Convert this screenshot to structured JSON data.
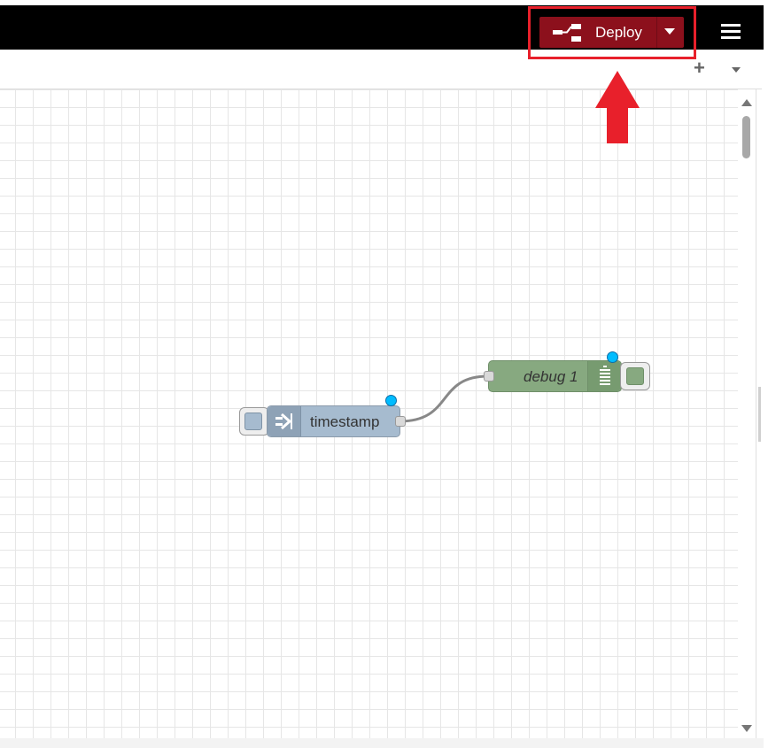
{
  "header": {
    "deploy_label": "Deploy",
    "deploy_icon": "deploy-icon",
    "menu_icon": "hamburger-menu-icon"
  },
  "tabbar": {
    "add_label": "+",
    "more_icon": "caret-down-icon"
  },
  "nodes": {
    "inject": {
      "label": "timestamp",
      "icon": "arrow-in-icon",
      "type": "inject"
    },
    "debug": {
      "label": "debug 1",
      "icon": "debug-list-icon",
      "type": "debug"
    }
  },
  "colors": {
    "header_bg": "#000000",
    "deploy_bg": "#8c101c",
    "highlight": "#e8202b",
    "inject_node": "#a6bbcf",
    "debug_node": "#87a980",
    "changed_dot": "#00bcff"
  }
}
